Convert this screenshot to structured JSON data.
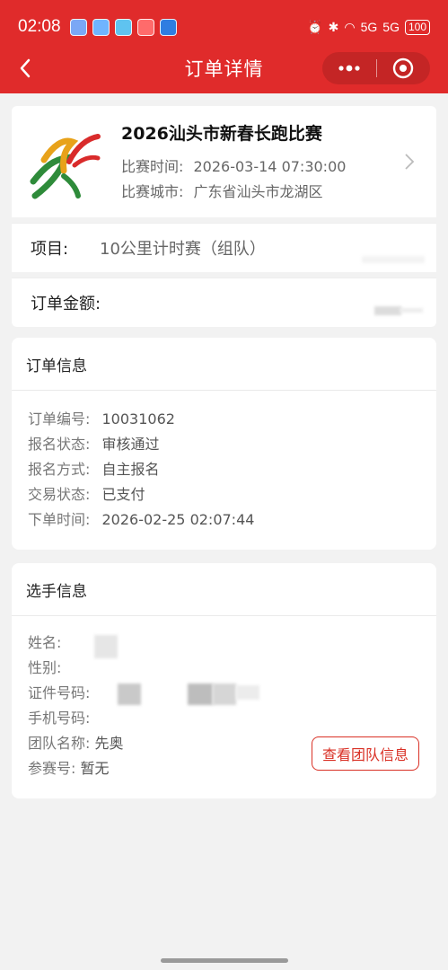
{
  "status_bar": {
    "time": "02:08",
    "signal_1": "5G",
    "signal_2": "5G",
    "battery": "100"
  },
  "nav": {
    "title": "订单详情",
    "more_icon": "ellipsis-icon",
    "close_icon": "target-circle-icon"
  },
  "event": {
    "name": "2026汕头市新春长跑比赛",
    "time_label": "比赛时间:",
    "time_value": "2026-03-14 07:30:00",
    "city_label": "比赛城市:",
    "city_value": "广东省汕头市龙湖区"
  },
  "project": {
    "label": "项目:",
    "value": "10公里计时赛（组队）"
  },
  "amount": {
    "label": "订单金额:"
  },
  "order_info": {
    "heading": "订单信息",
    "fields": [
      {
        "k": "订单编号:",
        "v": "10031062"
      },
      {
        "k": "报名状态:",
        "v": "审核通过"
      },
      {
        "k": "报名方式:",
        "v": "自主报名"
      },
      {
        "k": "交易状态:",
        "v": "已支付"
      },
      {
        "k": "下单时间:",
        "v": "2026-02-25 02:07:44"
      }
    ]
  },
  "player_info": {
    "heading": "选手信息",
    "fields": [
      {
        "k": "姓名:",
        "v": ""
      },
      {
        "k": "性别:",
        "v": ""
      },
      {
        "k": "证件号码:",
        "v": ""
      },
      {
        "k": "手机号码:",
        "v": ""
      },
      {
        "k": "团队名称:",
        "v": "先奥"
      },
      {
        "k": "参赛号:",
        "v": "暂无"
      }
    ],
    "team_button": "查看团队信息"
  },
  "colors": {
    "brand_red": "#e02b2b",
    "button_red": "#d93025"
  }
}
